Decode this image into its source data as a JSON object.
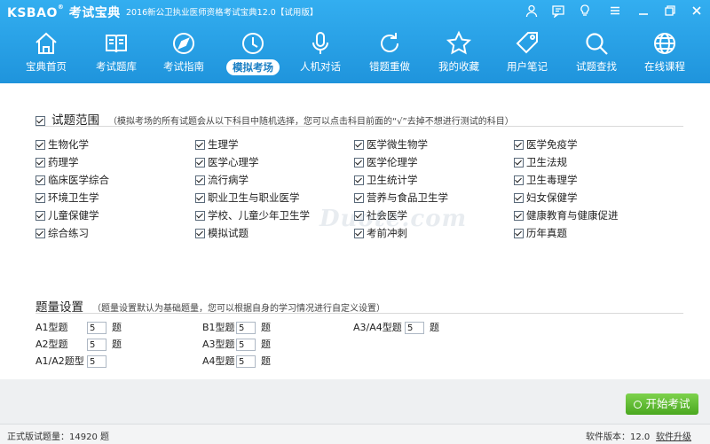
{
  "app": {
    "logo": "KSBAO",
    "logo_cn": "考试宝典",
    "title": "2016新公卫执业医师资格考试宝典12.0【试用版】"
  },
  "nav": [
    {
      "label": "宝典首页",
      "icon": "home-icon"
    },
    {
      "label": "考试题库",
      "icon": "book-icon"
    },
    {
      "label": "考试指南",
      "icon": "compass-icon"
    },
    {
      "label": "模拟考场",
      "icon": "clock-icon",
      "active": true
    },
    {
      "label": "人机对话",
      "icon": "microphone-icon"
    },
    {
      "label": "错题重做",
      "icon": "refresh-icon"
    },
    {
      "label": "我的收藏",
      "icon": "star-icon"
    },
    {
      "label": "用户笔记",
      "icon": "tag-icon"
    },
    {
      "label": "试题查找",
      "icon": "search-icon"
    },
    {
      "label": "在线课程",
      "icon": "globe-icon"
    }
  ],
  "scope": {
    "title": "试题范围",
    "note": "（模拟考场的所有试题会从以下科目中随机选择，您可以点击科目前面的“√”去掉不想进行测试的科目）",
    "subjects": [
      "生物化学",
      "生理学",
      "医学微生物学",
      "医学免疫学",
      "药理学",
      "医学心理学",
      "医学伦理学",
      "卫生法规",
      "临床医学综合",
      "流行病学",
      "卫生统计学",
      "卫生毒理学",
      "环境卫生学",
      "职业卫生与职业医学",
      "营养与食品卫生学",
      "妇女保健学",
      "儿童保健学",
      "学校、儿童少年卫生学",
      "社会医学",
      "健康教育与健康促进",
      "综合练习",
      "模拟试题",
      "考前冲刺",
      "历年真题"
    ]
  },
  "quantity": {
    "title": "题量设置",
    "note": "（题量设置默认为基础题量，您可以根据自身的学习情况进行自定义设置）",
    "unit": "题",
    "items": [
      {
        "label": "A1型题",
        "value": "5"
      },
      {
        "label": "B1型题",
        "value": "5"
      },
      {
        "label": "A3/A4型题",
        "value": "5"
      },
      {
        "label": "A2型题",
        "value": "5"
      },
      {
        "label": "A3型题",
        "value": "5"
      },
      {
        "label": "A1/A2题型",
        "value": "5"
      },
      {
        "label": "A4型题",
        "value": "5"
      }
    ]
  },
  "start_button": "开始考试",
  "status": {
    "count": "正式版试题量：14920 题",
    "version": "软件版本：12.0",
    "upgrade": "软件升级"
  },
  "watermark": "Duote.com",
  "colors": {
    "topbar": "#2aa3e8",
    "start": "#5fbf2f",
    "active_tab_text": "#1b7fc4"
  }
}
